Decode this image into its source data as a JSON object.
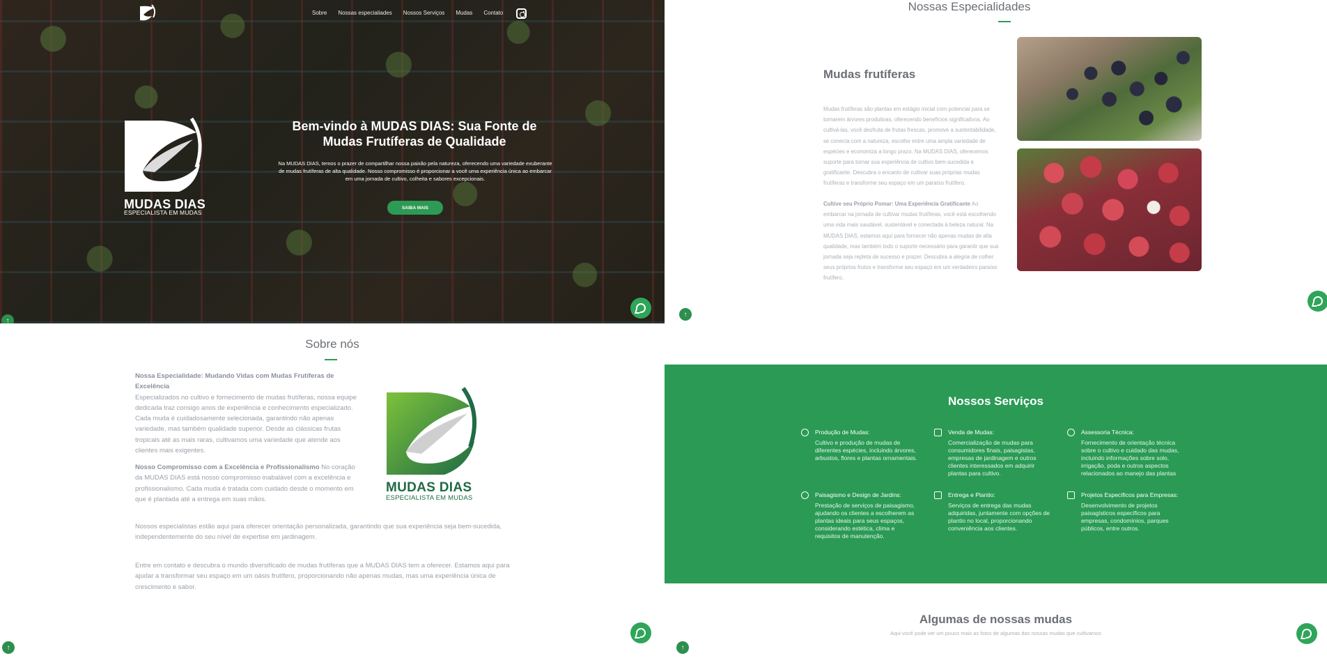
{
  "nav": {
    "items": [
      "Sobre",
      "Nossas especialiades",
      "Nossos Serviços",
      "Mudas",
      "Contato"
    ]
  },
  "brand": {
    "name": "MUDAS DIAS",
    "tagline": "ESPECIALISTA EM MUDAS"
  },
  "hero": {
    "title": "Bem-vindo à MUDAS DIAS: Sua Fonte de Mudas Frutíferas de Qualidade",
    "text": "Na MUDAS DIAS, temos o prazer de compartilhar nossa paixão pela natureza, oferecendo uma variedade exuberante de mudas frutíferas de alta qualidade. Nosso compromisso é proporcionar a você uma experiência única ao embarcar em uma jornada de cultivo, colheita e sabores excepcionais.",
    "button": "SAIBA MAIS"
  },
  "sobre": {
    "title": "Sobre nós",
    "p1_bold": "Nossa Especialidade: Mudando Vidas com Mudas Frutíferas de Excelência",
    "p1": "Especializados no cultivo e fornecimento de mudas frutíferas, nossa equipe dedicada traz consigo anos de experiência e conhecimento especializado. Cada muda é cuidadosamente selecionada, garantindo não apenas variedade, mas também qualidade superior. Desde as clássicas frutas tropicais até as mais raras, cultivamos uma variedade que atende aos clientes mais exigentes.",
    "p2_bold": "Nosso Compromisso com a Excelência e Profissionalismo",
    "p2": " No coração da MUDAS DIAS está nosso compromisso inabalável com a excelência e profissionalismo. Cada muda é tratada com cuidado desde o momento em que é plantada até a entrega em suas mãos.",
    "p3": "Nossos especialistas estão aqui para oferecer orientação personalizada, garantindo que sua experiência seja bem-sucedida, independentemente do seu nível de expertise em jardinagem.",
    "p4": "Entre em contato e descubra o mundo diversificado de mudas frutíferas que a MUDAS DIAS tem a oferecer. Estamos aqui para ajudar a transformar seu espaço em um oásis frutífero, proporcionando não apenas mudas, mas uma experiência única de crescimento e sabor."
  },
  "especialidades": {
    "title": "Nossas Especialidades",
    "subtitle": "Mudas frutíferas",
    "p1": "Mudas frutíferas são plantas em estágio inicial com potencial para se tornarem árvores produtivas, oferecendo benefícios significativos. Ao cultivá-las, você desfruta de frutas frescas, promove a sustentabilidade, se conecta com a natureza, escolhe entre uma ampla variedade de espécies e economiza a longo prazo. Na MUDAS DIAS, oferecemos suporte para tornar sua experiência de cultivo bem-sucedida e gratificante. Descubra o encanto de cultivar suas próprias mudas frutíferas e transforme seu espaço em um paraíso frutífero.",
    "p2_bold": "Cultive seu Próprio Pomar: Uma Experiência Gratificante",
    "p2": " Ao embarcar na jornada de cultivar mudas frutíferas, você está escolhendo uma vida mais saudável, sustentável e conectada à beleza natural. Na MUDAS DIAS, estamos aqui para fornecer não apenas mudas de alta qualidade, mas também todo o suporte necessário para garantir que sua jornada seja repleta de sucesso e prazer. Descubra a alegria de colher seus próprios frutos e transforme seu espaço em um verdadeiro paraíso frutífero."
  },
  "servicos": {
    "title": "Nossos Serviços",
    "items": [
      {
        "icon": "leaf-icon",
        "title": "Produção de Mudas:",
        "desc": "Cultivo e produção de mudas de diferentes espécies, incluindo árvores, arbustos, flores e plantas ornamentais."
      },
      {
        "icon": "cash-icon",
        "title": "Venda de Mudas:",
        "desc": "Comercialização de mudas para consumidores finais, paisagistas, empresas de jardinagem e outros clientes interessados em adquirir plantas para cultivo."
      },
      {
        "icon": "info-icon",
        "title": "Assessoria Técnica:",
        "desc": "Fornecimento de orientação técnica sobre o cultivo e cuidado das mudas, incluindo informações sobre solo, irrigação, poda e outros aspectos relacionados ao manejo das plantas"
      },
      {
        "icon": "info-icon",
        "title": "Paisagismo e Design de Jardins:",
        "desc": "Prestação de serviços de paisagismo, ajudando os clientes a escolherem as plantas ideais para seus espaços, considerando estética, clima e requisitos de manutenção."
      },
      {
        "icon": "box-icon",
        "title": "Entrega e Plantio:",
        "desc": "Serviços de entrega das mudas adquiridas, juntamente com opções de plantio no local, proporcionando conveniência aos clientes."
      },
      {
        "icon": "check-square-icon",
        "title": "Projetos Específicos para Empresas:",
        "desc": "Desenvolvimento de projetos paisagísticos específicos para empresas, condomínios, parques públicos, entre outros."
      }
    ]
  },
  "mudas": {
    "title": "Algumas de nossas mudas",
    "subtitle": "Aqui você pode ver um pouco mais as fotos de algumas das nossas mudas que cultivamos"
  },
  "colors": {
    "accent": "#2a9a55",
    "dark_green": "#1f6b45"
  }
}
